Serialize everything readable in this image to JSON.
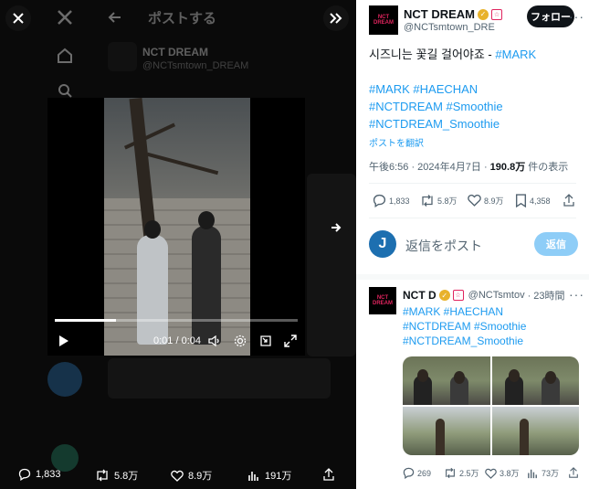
{
  "viewer": {
    "header_title": "ポストする",
    "ghost_name": "NCT DREAM",
    "ghost_handle": "@NCTsmtown_DREAM",
    "video": {
      "time_text": "0:01 / 0:04",
      "progress": 0.25
    },
    "stats": {
      "replies": "1,833",
      "reposts": "5.8万",
      "likes": "8.9万",
      "views": "191万"
    }
  },
  "post": {
    "author_name": "NCT DREAM",
    "author_handle": "@NCTsmtown_DRE",
    "avatar_text": "NCT DREAM",
    "follow_label": "フォロー",
    "text_line": "시즈니는 꽃길 걸어야죠 - ",
    "text_tag": "#MARK",
    "hashtags": [
      "#MARK #HAECHAN",
      "#NCTDREAM #Smoothie",
      "#NCTDREAM_Smoothie"
    ],
    "translate_label": "ポストを翻訳",
    "time": "午後6:56 · 2024年4月7日 · ",
    "views_count": "190.8万",
    "views_suffix": " 件の表示",
    "actions": {
      "replies": "1,833",
      "reposts": "5.8万",
      "likes": "8.9万",
      "bookmarks": "4,358"
    },
    "reply_avatar": "J",
    "reply_placeholder": "返信をポスト",
    "reply_button": "返信"
  },
  "thread": {
    "author_name": "NCT D",
    "author_handle": "@NCTsmtov",
    "time": "· 23時間",
    "lines": [
      "#MARK #HAECHAN",
      "#NCTDREAM #Smoothie",
      "#NCTDREAM_Smoothie"
    ],
    "actions": {
      "replies": "269",
      "reposts": "2.5万",
      "likes": "3.8万",
      "views": "73万"
    }
  }
}
